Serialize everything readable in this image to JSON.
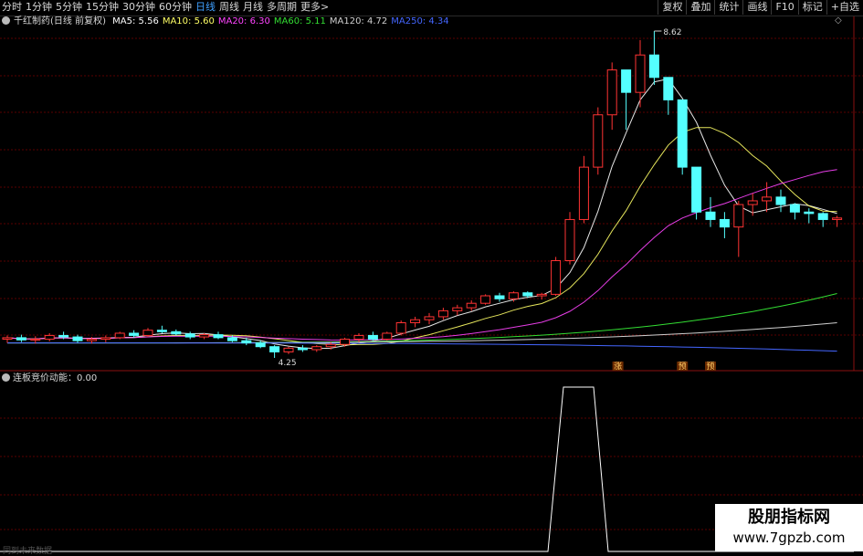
{
  "toolbar": {
    "tabs": [
      "分时",
      "1分钟",
      "5分钟",
      "15分钟",
      "30分钟",
      "60分钟",
      "日线",
      "周线",
      "月线",
      "多周期",
      "更多>"
    ],
    "active_tab": "日线",
    "right": [
      "复权",
      "叠加",
      "统计",
      "画线",
      "F10",
      "标记",
      "+自选"
    ]
  },
  "main_info": {
    "stock": "千红制药(日线 前复权)",
    "ma": [
      {
        "label": "MA5: 5.56",
        "color": "#ffffff"
      },
      {
        "label": "MA10: 5.60",
        "color": "#ffff66"
      },
      {
        "label": "MA20: 6.30",
        "color": "#ff44ff"
      },
      {
        "label": "MA60: 5.11",
        "color": "#33dd33"
      },
      {
        "label": "MA120: 4.72",
        "color": "#d0d0d0"
      },
      {
        "label": "MA250: 4.34",
        "color": "#4466ff"
      }
    ]
  },
  "indicator": {
    "label": "连板竞价动能：0.00"
  },
  "annotations": {
    "high": "8.62",
    "low": "4.25",
    "marks": [
      "涨",
      "预",
      "预"
    ]
  },
  "watermark": {
    "title": "股朋指标网",
    "url": "www.7gpzb.com"
  },
  "footer": {
    "future": "同到未来数据"
  },
  "colors": {
    "up": "#ff3333",
    "down": "#54ffff",
    "grid": "#5a0000"
  },
  "chart_data": {
    "type": "candlestick",
    "candles": [
      [
        4.5,
        4.55,
        4.45,
        4.52
      ],
      [
        4.52,
        4.56,
        4.46,
        4.49
      ],
      [
        4.49,
        4.54,
        4.44,
        4.5
      ],
      [
        4.5,
        4.58,
        4.47,
        4.55
      ],
      [
        4.55,
        4.6,
        4.5,
        4.53
      ],
      [
        4.53,
        4.56,
        4.45,
        4.48
      ],
      [
        4.48,
        4.53,
        4.44,
        4.5
      ],
      [
        4.5,
        4.55,
        4.46,
        4.52
      ],
      [
        4.52,
        4.6,
        4.5,
        4.58
      ],
      [
        4.58,
        4.62,
        4.52,
        4.55
      ],
      [
        4.55,
        4.65,
        4.53,
        4.62
      ],
      [
        4.62,
        4.68,
        4.58,
        4.6
      ],
      [
        4.6,
        4.63,
        4.55,
        4.57
      ],
      [
        4.57,
        4.6,
        4.5,
        4.53
      ],
      [
        4.53,
        4.58,
        4.5,
        4.56
      ],
      [
        4.56,
        4.6,
        4.5,
        4.52
      ],
      [
        4.52,
        4.55,
        4.46,
        4.48
      ],
      [
        4.48,
        4.52,
        4.42,
        4.45
      ],
      [
        4.45,
        4.48,
        4.38,
        4.4
      ],
      [
        4.4,
        4.42,
        4.25,
        4.33
      ],
      [
        4.33,
        4.4,
        4.3,
        4.38
      ],
      [
        4.38,
        4.42,
        4.33,
        4.36
      ],
      [
        4.36,
        4.42,
        4.33,
        4.4
      ],
      [
        4.4,
        4.46,
        4.36,
        4.43
      ],
      [
        4.43,
        4.52,
        4.4,
        4.5
      ],
      [
        4.5,
        4.58,
        4.46,
        4.55
      ],
      [
        4.55,
        4.6,
        4.48,
        4.5
      ],
      [
        4.5,
        4.6,
        4.48,
        4.58
      ],
      [
        4.58,
        4.75,
        4.55,
        4.72
      ],
      [
        4.72,
        4.8,
        4.66,
        4.76
      ],
      [
        4.76,
        4.85,
        4.7,
        4.8
      ],
      [
        4.8,
        4.92,
        4.76,
        4.88
      ],
      [
        4.88,
        4.96,
        4.82,
        4.92
      ],
      [
        4.92,
        5.02,
        4.88,
        4.98
      ],
      [
        4.98,
        5.1,
        4.96,
        5.08
      ],
      [
        5.08,
        5.12,
        5.0,
        5.04
      ],
      [
        5.04,
        5.14,
        5.0,
        5.12
      ],
      [
        5.12,
        5.14,
        5.05,
        5.08
      ],
      [
        5.08,
        5.12,
        5.03,
        5.1
      ],
      [
        5.1,
        5.6,
        5.08,
        5.55
      ],
      [
        5.55,
        6.2,
        5.5,
        6.1
      ],
      [
        6.1,
        6.95,
        6.05,
        6.8
      ],
      [
        6.8,
        7.6,
        6.7,
        7.5
      ],
      [
        7.5,
        8.2,
        7.3,
        8.1
      ],
      [
        8.1,
        8.0,
        7.3,
        7.8
      ],
      [
        7.8,
        8.5,
        7.6,
        8.3
      ],
      [
        8.3,
        8.62,
        7.9,
        8.0
      ],
      [
        8.0,
        7.9,
        7.5,
        7.7
      ],
      [
        7.7,
        7.6,
        6.7,
        6.8
      ],
      [
        6.8,
        6.75,
        6.1,
        6.2
      ],
      [
        6.2,
        6.4,
        6.0,
        6.1
      ],
      [
        6.1,
        6.2,
        5.85,
        6.0
      ],
      [
        6.0,
        6.35,
        5.6,
        6.3
      ],
      [
        6.3,
        6.45,
        6.15,
        6.35
      ],
      [
        6.35,
        6.6,
        6.2,
        6.4
      ],
      [
        6.4,
        6.5,
        6.2,
        6.3
      ],
      [
        6.3,
        6.32,
        6.1,
        6.2
      ],
      [
        6.2,
        6.25,
        6.05,
        6.18
      ],
      [
        6.18,
        6.2,
        6.0,
        6.1
      ],
      [
        6.1,
        6.15,
        6.0,
        6.12
      ]
    ]
  }
}
